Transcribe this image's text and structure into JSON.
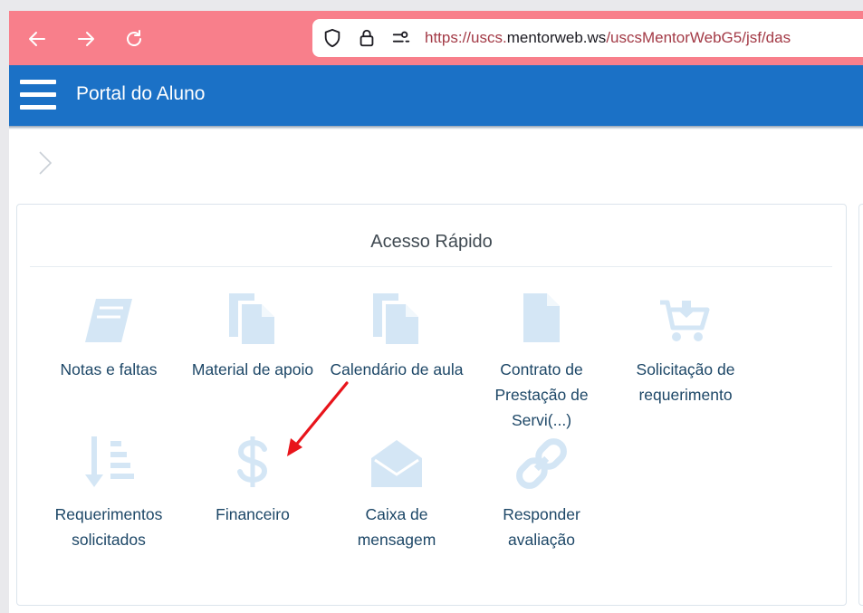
{
  "browser": {
    "url_prefix": "https://uscs.",
    "url_host": "mentorweb.ws",
    "url_path": "/uscsMentorWebG5/jsf/das",
    "toolbar_color": "#f87f8b"
  },
  "header": {
    "title": "Portal do Aluno",
    "color": "#1b71c6"
  },
  "quick_access": {
    "title": "Acesso Rápido",
    "icon_color": "#d4e6f5",
    "tiles": [
      {
        "label": "Notas e faltas",
        "icon": "book-icon"
      },
      {
        "label": "Material de apoio",
        "icon": "copy-document-icon"
      },
      {
        "label": "Calendário de aula",
        "icon": "copy-document-icon"
      },
      {
        "label": "Contrato de Prestação de Servi(...)",
        "icon": "document-icon"
      },
      {
        "label": "Solicitação de requerimento",
        "icon": "cart-icon"
      },
      {
        "label": "Requerimentos solicitados",
        "icon": "sort-list-icon"
      },
      {
        "label": "Financeiro",
        "icon": "dollar-icon"
      },
      {
        "label": "Caixa de mensagem",
        "icon": "envelope-open-icon"
      },
      {
        "label": "Responder avaliação",
        "icon": "link-icon"
      }
    ]
  },
  "annotation": {
    "color": "#e8141b"
  }
}
